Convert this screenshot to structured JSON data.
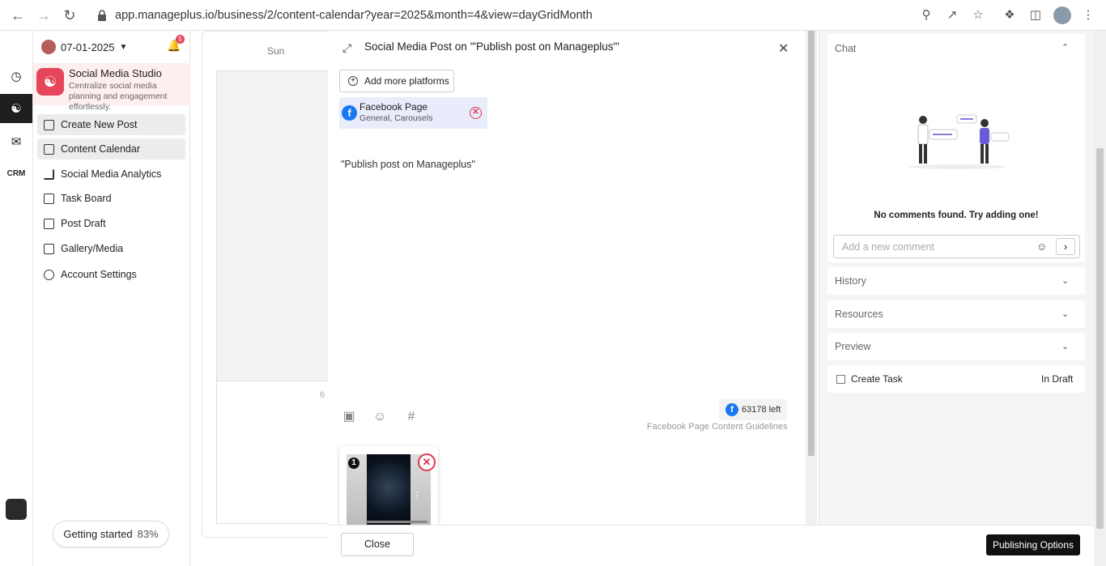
{
  "browser": {
    "url": "app.manageplus.io/business/2/content-calendar?year=2025&month=4&view=dayGridMonth"
  },
  "sidebar": {
    "date": "07-01-2025",
    "notification_count": "5",
    "brand_title": "Social Media Studio",
    "brand_subtitle": "Centralize social media planning and engagement effortlessly.",
    "items": [
      {
        "label": "Create New Post"
      },
      {
        "label": "Content Calendar"
      },
      {
        "label": "Social Media Analytics"
      },
      {
        "label": "Task Board"
      },
      {
        "label": "Post Draft"
      },
      {
        "label": "Gallery/Media"
      },
      {
        "label": "Account Settings"
      }
    ],
    "getting_started": {
      "label": "Getting started",
      "percent": "83%"
    }
  },
  "calendar": {
    "day_header": "Sun",
    "day_number": "6"
  },
  "modal": {
    "title": "Social Media Post on '\"Publish post on Manageplus\"'",
    "add_platforms_label": "Add more platforms",
    "platform": {
      "name": "Facebook Page",
      "subtitle": "General, Carousels"
    },
    "post_text": "\"Publish post on Manageplus\"",
    "chars_left": "63178 left",
    "guidelines_link": "Facebook Page Content Guidelines",
    "thumbnail_index": "1",
    "close_label": "Close",
    "publish_label": "Publishing Options"
  },
  "right_panel": {
    "chat_title": "Chat",
    "no_comments": "No comments found. Try adding one!",
    "comment_placeholder": "Add a new comment",
    "history_label": "History",
    "resources_label": "Resources",
    "preview_label": "Preview",
    "task_label": "Create Task",
    "task_status": "In Draft"
  },
  "colors": {
    "brand": "#e6465b",
    "facebook": "#1877f2",
    "remove": "#e0364f"
  }
}
